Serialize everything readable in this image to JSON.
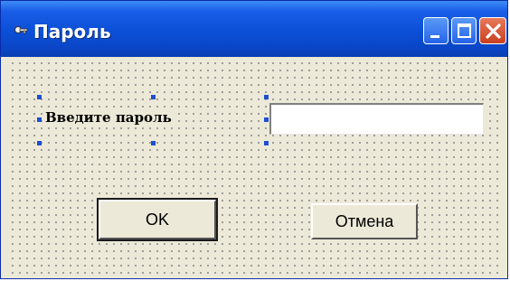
{
  "window": {
    "title": "Пароль",
    "icon": "key-icon"
  },
  "titlebar_buttons": {
    "minimize": "minimize-icon",
    "maximize": "maximize-icon",
    "close": "close-icon"
  },
  "form": {
    "label": "Введите пароль",
    "password_value": ""
  },
  "buttons": {
    "ok_label": "OK",
    "cancel_label": "Отмена"
  },
  "colors": {
    "titlebar": "#0b4fd6",
    "window_bg": "#ece9d8",
    "selection_handle": "#1f4fd0",
    "close_button": "#c8401f"
  }
}
